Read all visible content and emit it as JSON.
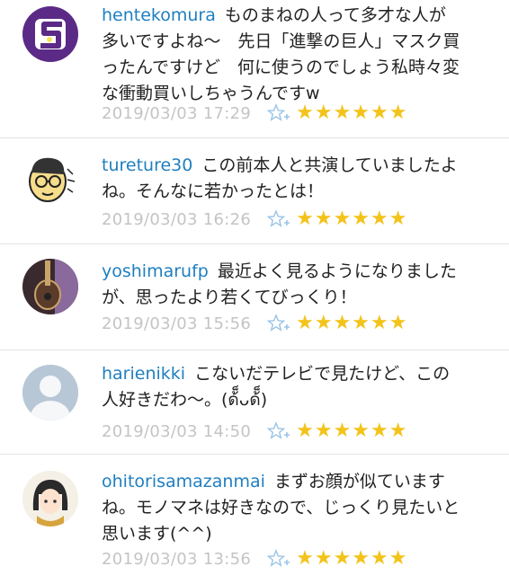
{
  "comments": [
    {
      "user": "hentekomura",
      "text": "ものまねの人って多才な人が多いですよね〜　先日「進撃の巨人」マスク買ったんですけど　何に使うのでしょう私時々変な衝動買いしちゃうんですw",
      "time": "2019/03/03 17:29",
      "stars": "★★★★★★",
      "avatar_icon": "logo-avatar-icon"
    },
    {
      "user": "tureture30",
      "text": "この前本人と共演していましたよね。そんなに若かったとは！",
      "time": "2019/03/03 16:26",
      "stars": "★★★★★★",
      "avatar_icon": "cartoon-face-avatar-icon"
    },
    {
      "user": "yoshimarufp",
      "text": "最近よく見るようになりましたが、思ったより若くてびっくり！",
      "time": "2019/03/03 15:56",
      "stars": "★★★★★★",
      "avatar_icon": "guitar-avatar-icon"
    },
    {
      "user": "harienikki",
      "text": "こないだテレビで見たけど、この人好きだわ〜。(ด้็ᴗด้็)",
      "time": "2019/03/03 14:50",
      "stars": "★★★★★★",
      "avatar_icon": "default-person-avatar-icon"
    },
    {
      "user": "ohitorisamazanmai",
      "text": "まずお顔が似ていますね。モノマネは好きなので、じっくり見たいと思います(^^)",
      "time": "2019/03/03 13:56",
      "stars": "★★★★★★",
      "avatar_icon": "anime-girl-avatar-icon"
    }
  ],
  "colors": {
    "username": "#1f7fc0",
    "timestamp": "#c4c4c4",
    "stars": "#f3c31a",
    "divider": "#e4e4e4"
  }
}
